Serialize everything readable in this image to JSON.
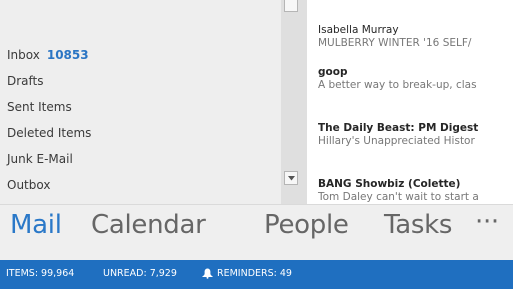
{
  "folders": [
    {
      "label": "Inbox",
      "count": "10853"
    },
    {
      "label": "Drafts"
    },
    {
      "label": "Sent Items"
    },
    {
      "label": "Deleted Items"
    },
    {
      "label": "Junk E-Mail"
    },
    {
      "label": "Outbox"
    }
  ],
  "messages": [
    {
      "sender": "Isabella Murray",
      "preview": "MULBERRY WINTER '16  SELF/"
    },
    {
      "sender": "goop",
      "preview": "A better way to break-up, clas"
    },
    {
      "sender": "The Daily Beast: PM Digest",
      "preview": "Hillary's Unappreciated Histor"
    },
    {
      "sender": "BANG Showbiz (Colette)",
      "preview": "Tom Daley can't wait to start a"
    }
  ],
  "nav": {
    "mail": "Mail",
    "calendar": "Calendar",
    "people": "People",
    "tasks": "Tasks",
    "more": "···"
  },
  "status": {
    "items": "ITEMS: 99,964",
    "unread": "UNREAD: 7,929",
    "reminders": "REMINDERS: 49"
  },
  "colors": {
    "accent": "#2a78c8",
    "status_bar": "#1f6fc0"
  }
}
